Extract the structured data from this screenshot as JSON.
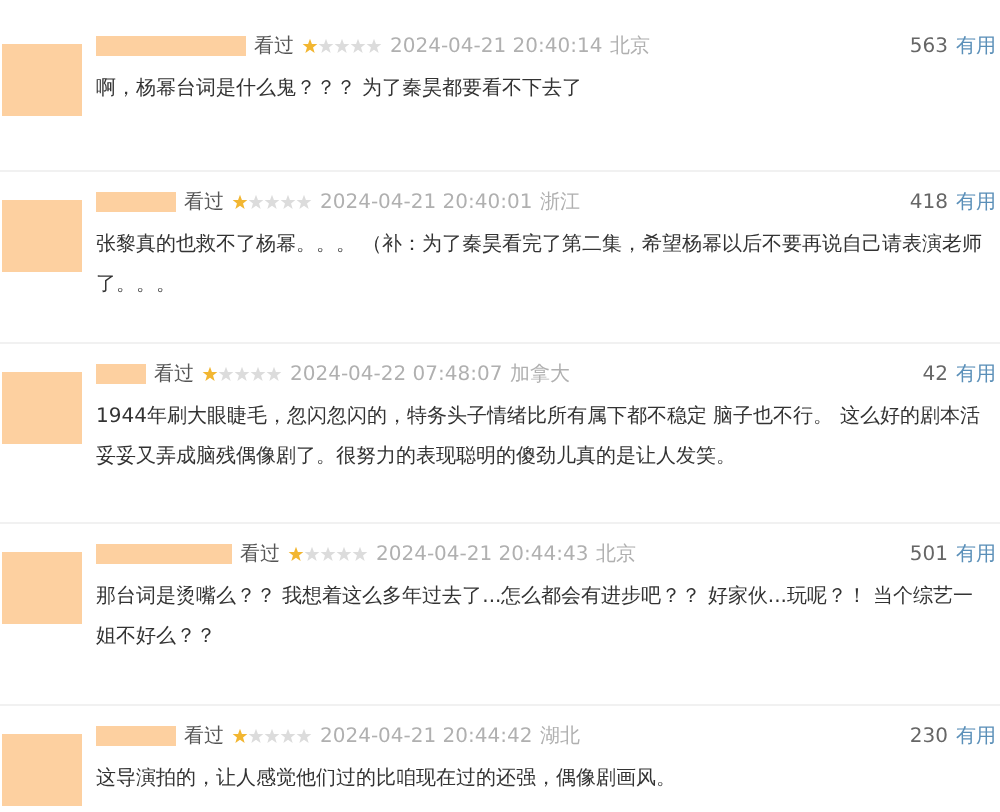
{
  "reviews": [
    {
      "status": "看过",
      "stars": 1,
      "time": "2024-04-21 20:40:14",
      "location": "北京",
      "votes": "563",
      "vote_label": "有用",
      "text": "啊，杨幂台词是什么鬼？？？ 为了秦昊都要看不下去了"
    },
    {
      "status": "看过",
      "stars": 1,
      "time": "2024-04-21 20:40:01",
      "location": "浙江",
      "votes": "418",
      "vote_label": "有用",
      "text": "张黎真的也救不了杨幂。。。 （补：为了秦昊看完了第二集，希望杨幂以后不要再说自己请表演老师了。。。"
    },
    {
      "status": "看过",
      "stars": 1,
      "time": "2024-04-22 07:48:07",
      "location": "加拿大",
      "votes": "42",
      "vote_label": "有用",
      "text": "1944年刷大眼睫毛，忽闪忽闪的，特务头子情绪比所有属下都不稳定 脑子也不行。 这么好的剧本活妥妥又弄成脑残偶像剧了。很努力的表现聪明的傻劲儿真的是让人发笑。"
    },
    {
      "status": "看过",
      "stars": 1,
      "time": "2024-04-21 20:44:43",
      "location": "北京",
      "votes": "501",
      "vote_label": "有用",
      "text": "那台词是烫嘴么？？ 我想着这么多年过去了...怎么都会有进步吧？？ 好家伙...玩呢？！ 当个综艺一姐不好么？？"
    },
    {
      "status": "看过",
      "stars": 1,
      "time": "2024-04-21 20:44:42",
      "location": "湖北",
      "votes": "230",
      "vote_label": "有用",
      "text": "这导演拍的，让人感觉他们过的比咱现在过的还强，偶像剧画风。"
    }
  ]
}
